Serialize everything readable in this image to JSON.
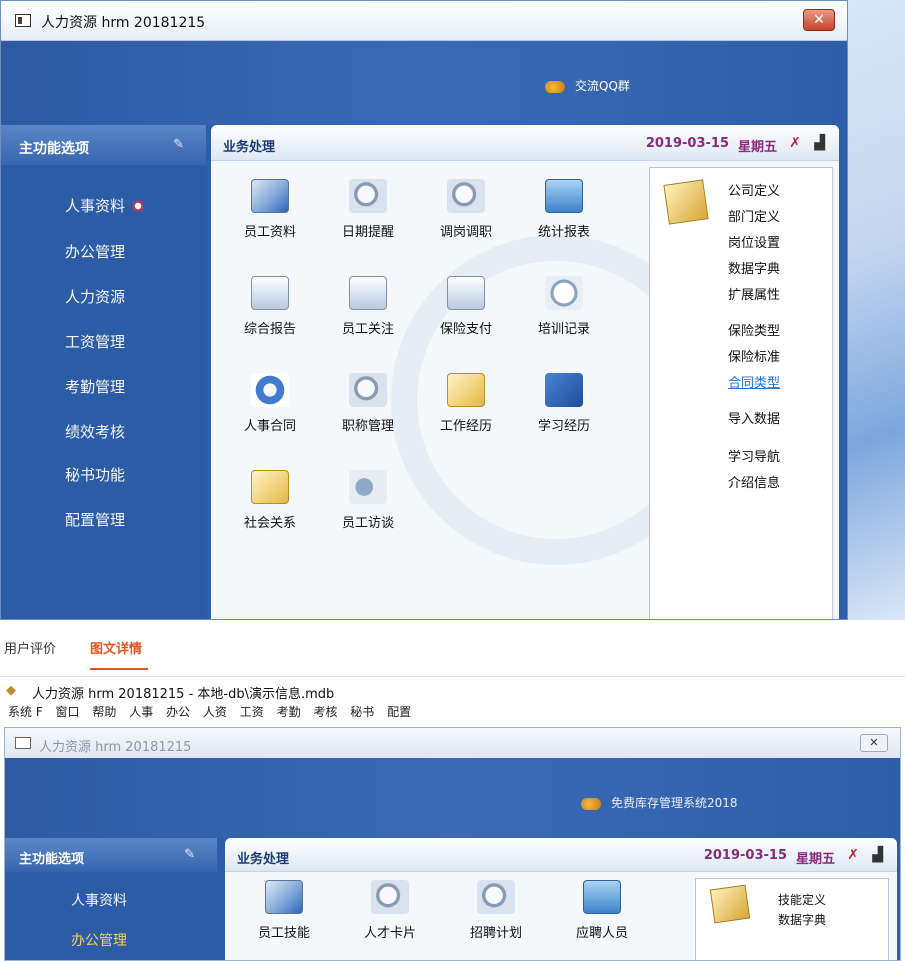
{
  "window1": {
    "title": "人力资源 hrm 20181215",
    "close": "✕",
    "banner_link": "交流QQ群",
    "sidebar_title": "主功能选项",
    "sidebar": [
      "人事资料",
      "办公管理",
      "人力资源",
      "工资管理",
      "考勤管理",
      "绩效考核",
      "秘书功能",
      "配置管理"
    ],
    "main_title": "业务处理",
    "date": "2019-03-15",
    "weekday": "星期五",
    "tiles": [
      {
        "label": "员工资料",
        "icon": "doc"
      },
      {
        "label": "日期提醒",
        "icon": "mag"
      },
      {
        "label": "调岗调职",
        "icon": "mag"
      },
      {
        "label": "统计报表",
        "icon": "calc"
      },
      {
        "label": "综合报告",
        "icon": "page"
      },
      {
        "label": "员工关注",
        "icon": "page"
      },
      {
        "label": "保险支付",
        "icon": "page"
      },
      {
        "label": "培训记录",
        "icon": "clock"
      },
      {
        "label": "人事合同",
        "icon": "gear"
      },
      {
        "label": "职称管理",
        "icon": "mag"
      },
      {
        "label": "工作经历",
        "icon": "note"
      },
      {
        "label": "学习经历",
        "icon": "book"
      },
      {
        "label": "社会关系",
        "icon": "note"
      },
      {
        "label": "员工访谈",
        "icon": "horn"
      }
    ],
    "right_links": [
      "公司定义",
      "部门定义",
      "岗位设置",
      "数据字典",
      "扩展属性",
      "保险类型",
      "保险标准",
      "合同类型",
      "导入数据",
      "学习导航",
      "介绍信息"
    ]
  },
  "tabs": {
    "reviews": "用户评价",
    "details": "图文详情"
  },
  "app2": {
    "title": "人力资源 hrm 20181215 - 本地-db\\演示信息.mdb",
    "menu": [
      "系统 F",
      "窗口",
      "帮助",
      "人事",
      "办公",
      "人资",
      "工资",
      "考勤",
      "考核",
      "秘书",
      "配置"
    ],
    "window_title": "人力资源 hrm 20181215",
    "close": "✕",
    "banner_link": "免费库存管理系统2018",
    "sidebar_title": "主功能选项",
    "sidebar": [
      "人事资料",
      "办公管理"
    ],
    "main_title": "业务处理",
    "date": "2019-03-15",
    "weekday": "星期五",
    "tiles": [
      {
        "label": "员工技能",
        "icon": "doc"
      },
      {
        "label": "人才卡片",
        "icon": "mag"
      },
      {
        "label": "招聘计划",
        "icon": "mag"
      },
      {
        "label": "应聘人员",
        "icon": "calc"
      }
    ],
    "right_links": [
      "技能定义",
      "数据字典"
    ]
  }
}
